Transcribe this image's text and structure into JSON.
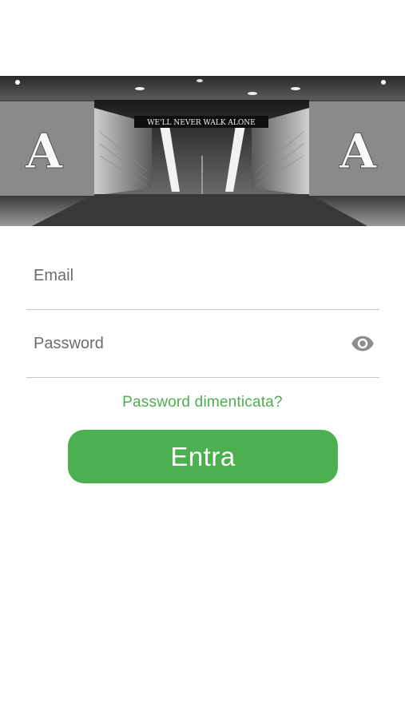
{
  "hero": {
    "banner_text": "WE'LL NEVER WALK ALONE",
    "logo_letter": "A"
  },
  "form": {
    "email_placeholder": "Email",
    "password_placeholder": "Password",
    "forgot_label": "Password dimenticata?",
    "submit_label": "Entra",
    "show_password_icon": "eye-icon"
  },
  "colors": {
    "accent": "#4caf50",
    "divider": "#c8c8c8",
    "icon": "#8e8e8e"
  }
}
